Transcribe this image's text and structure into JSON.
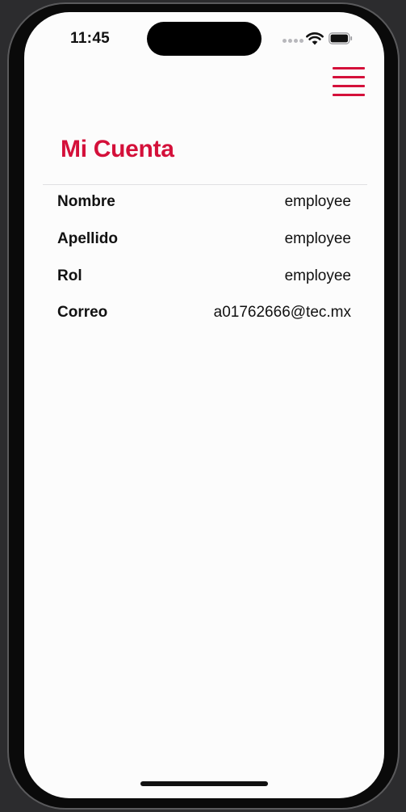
{
  "status_bar": {
    "time": "11:45"
  },
  "header": {
    "menu_icon": "hamburger-menu-icon",
    "title": "Mi Cuenta"
  },
  "account": {
    "rows": [
      {
        "label": "Nombre",
        "value": "employee"
      },
      {
        "label": "Apellido",
        "value": "employee"
      },
      {
        "label": "Rol",
        "value": "employee"
      },
      {
        "label": "Correo",
        "value": "a01762666@tec.mx"
      }
    ]
  },
  "colors": {
    "accent": "#d4103a",
    "background": "#fcfcfc",
    "text": "#111111"
  }
}
